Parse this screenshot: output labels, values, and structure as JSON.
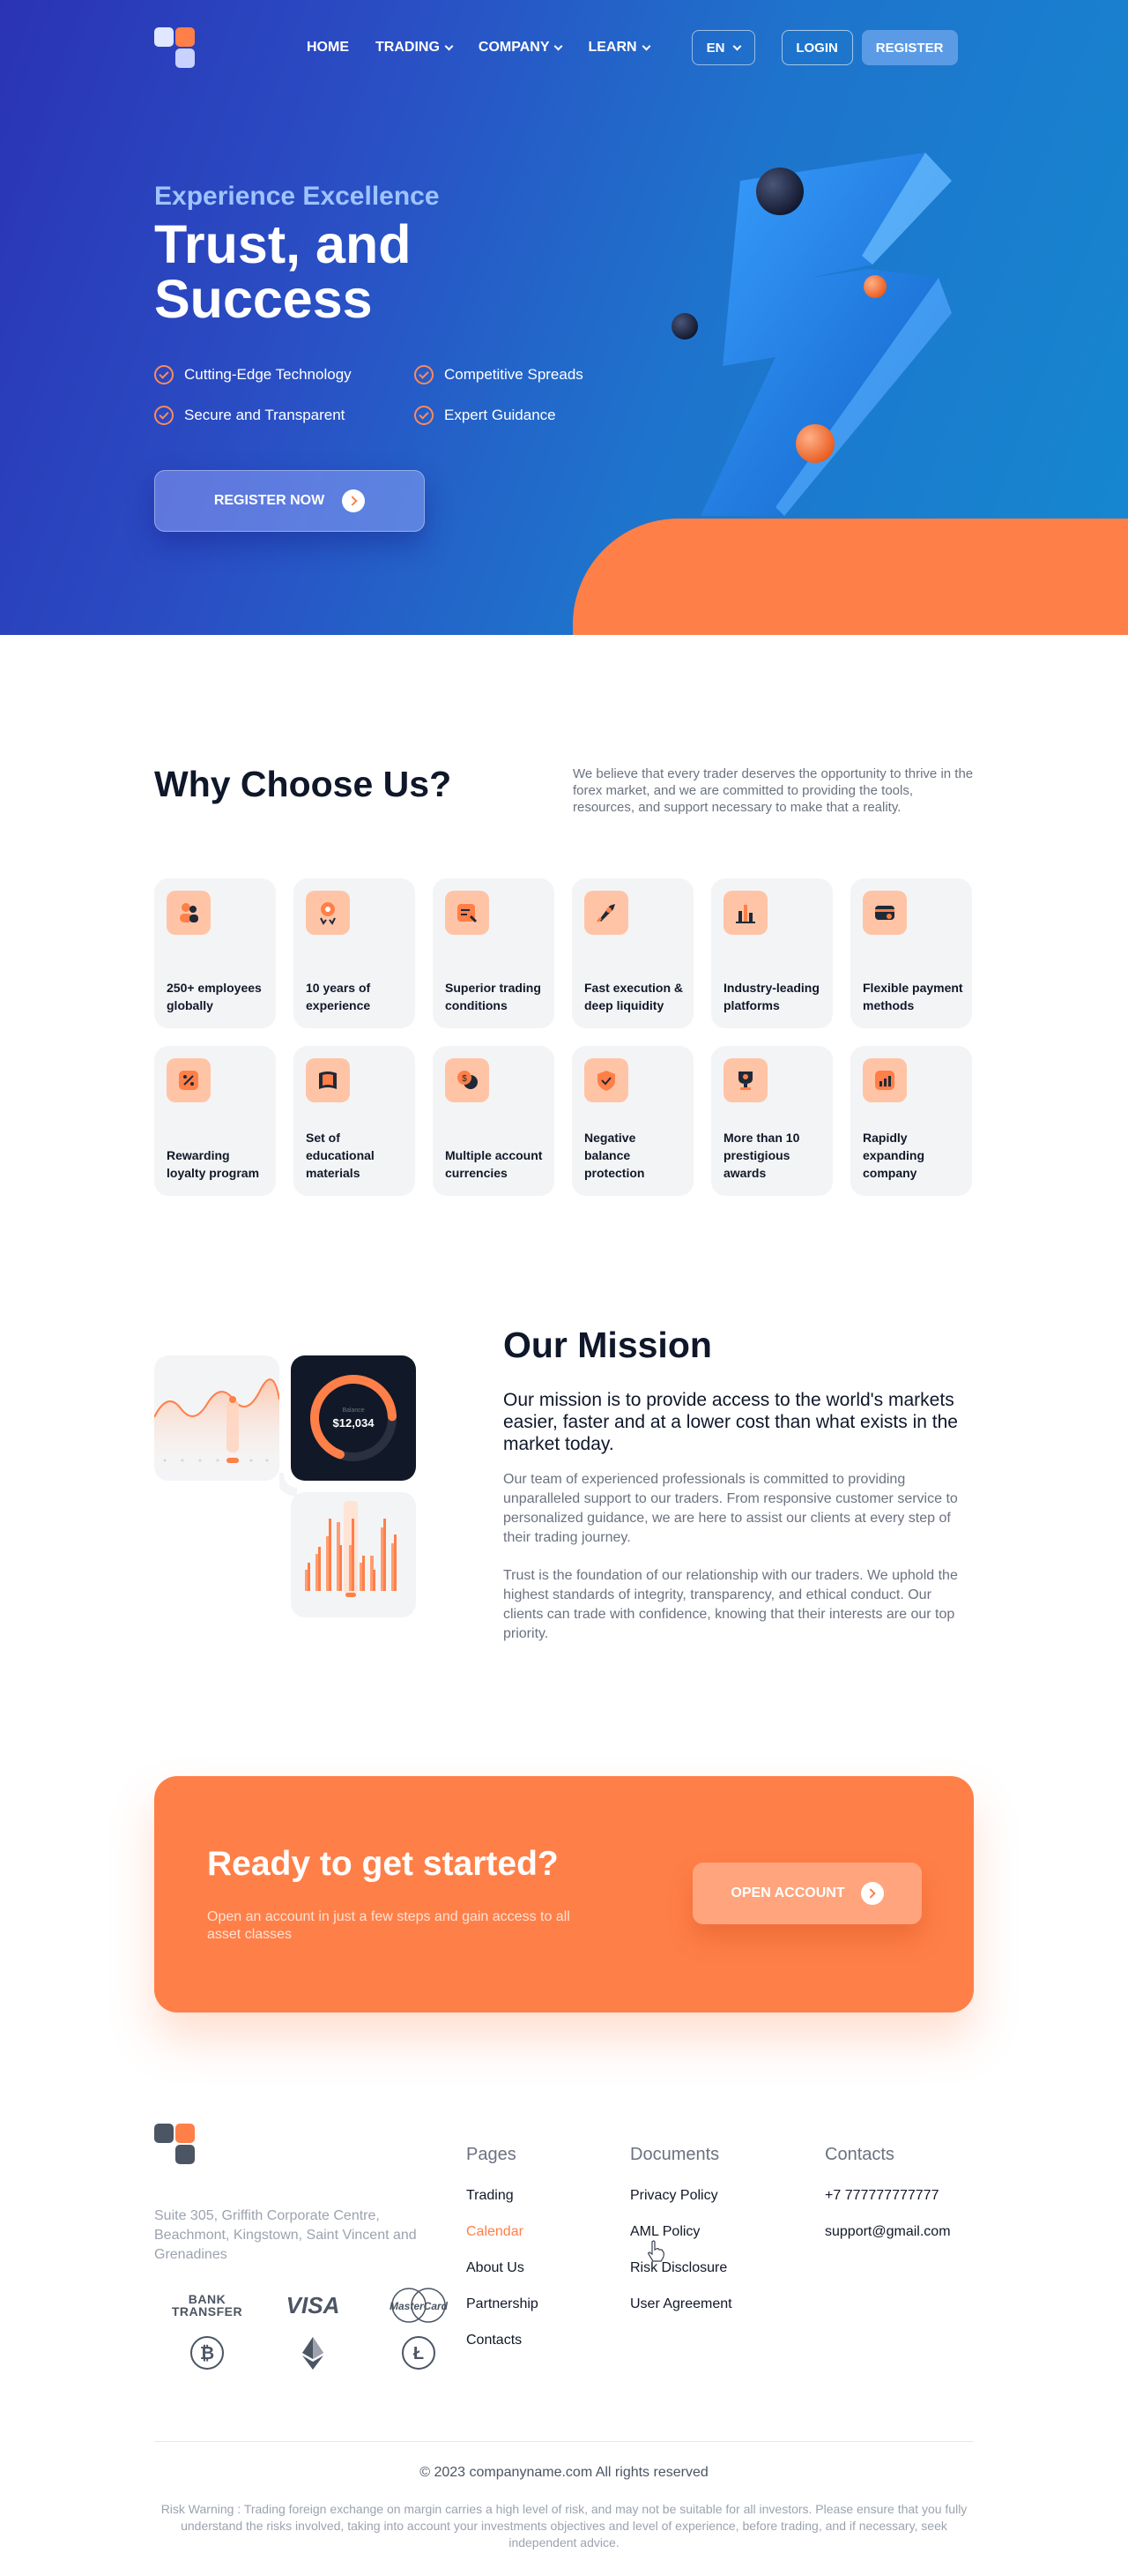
{
  "nav": {
    "items": [
      {
        "label": "HOME",
        "dropdown": false
      },
      {
        "label": "TRADING",
        "dropdown": true
      },
      {
        "label": "COMPANY",
        "dropdown": true
      },
      {
        "label": "LEARN",
        "dropdown": true
      }
    ],
    "language": "EN",
    "login": "LOGIN",
    "register": "REGISTER"
  },
  "hero": {
    "subtitle": "Experience Excellence",
    "title_line1": "Trust, and",
    "title_line2": "Success",
    "features": [
      "Cutting-Edge Technology",
      "Competitive Spreads",
      "Secure and Transparent",
      "Expert Guidance"
    ],
    "cta": "REGISTER NOW"
  },
  "why": {
    "title": "Why Choose Us?",
    "description": "We believe that every trader deserves the opportunity to thrive in the forex market, and we are committed to providing the tools, resources, and support necessary to make that a reality.",
    "cards": [
      {
        "label": "250+ employees globally",
        "icon": "people-icon"
      },
      {
        "label": "10 years of experience",
        "icon": "medal-icon"
      },
      {
        "label": "Superior trading conditions",
        "icon": "document-icon"
      },
      {
        "label": "Fast execution & deep liquidity",
        "icon": "rocket-icon"
      },
      {
        "label": "Industry-leading platforms",
        "icon": "bar-chart-icon"
      },
      {
        "label": "Flexible payment methods",
        "icon": "credit-card-icon"
      },
      {
        "label": "Rewarding loyalty program",
        "icon": "percent-icon"
      },
      {
        "label": "Set of educational materials",
        "icon": "book-icon"
      },
      {
        "label": "Multiple account currencies",
        "icon": "coins-icon"
      },
      {
        "label": "Negative balance protection",
        "icon": "shield-check-icon"
      },
      {
        "label": "More than 10 prestigious awards",
        "icon": "trophy-icon"
      },
      {
        "label": "Rapidly expanding company",
        "icon": "growth-chart-icon"
      }
    ]
  },
  "mission": {
    "title": "Our Mission",
    "lead": "Our mission is to provide access to the world's markets easier, faster and at a lower cost than what exists in the market today.",
    "p1": "Our team of experienced professionals is committed to providing unparalleled support to our traders. From responsive customer service to personalized guidance, we are here to assist our clients at every step of their trading journey.",
    "p2": "Trust is the foundation of our relationship with our traders. We uphold the highest standards of integrity, transparency, and ethical conduct. Our clients can trade with confidence, knowing that their interests are our top priority.",
    "balance_label": "Balance",
    "balance_value": "$12,034"
  },
  "ready": {
    "title": "Ready to get started?",
    "subtitle": "Open an account in just a few steps and gain access to all asset classes",
    "cta": "OPEN ACCOUNT"
  },
  "footer": {
    "address": "Suite 305, Griffith Corporate Centre, Beachmont, Kingstown, Saint Vincent and Grenadines",
    "pages_title": "Pages",
    "pages": [
      "Trading",
      "Calendar",
      "About Us",
      "Partnership",
      "Contacts"
    ],
    "documents_title": "Documents",
    "documents": [
      "Privacy Policy",
      "AML Policy",
      "Risk Disclosure",
      "User Agreement"
    ],
    "contacts_title": "Contacts",
    "phone": "+7 777777777777",
    "email": "support@gmail.com",
    "payments": {
      "bank_line1": "BANK",
      "bank_line2": "TRANSFER",
      "visa": "VISA",
      "mastercard": "MasterCard"
    },
    "copyright": "© 2023 companyname.com All rights reserved",
    "risk": "Risk Warning : Trading foreign exchange on margin carries a high level of risk, and may not be suitable for all investors. Please ensure that you fully understand the risks involved, taking into account your investments objectives and level of experience, before trading, and if necessary, seek independent advice."
  },
  "colors": {
    "accent": "#ff7f48",
    "hero_blue": "#2a33b4",
    "hero_blue_light": "#1588d0",
    "dark": "#0f172a"
  }
}
